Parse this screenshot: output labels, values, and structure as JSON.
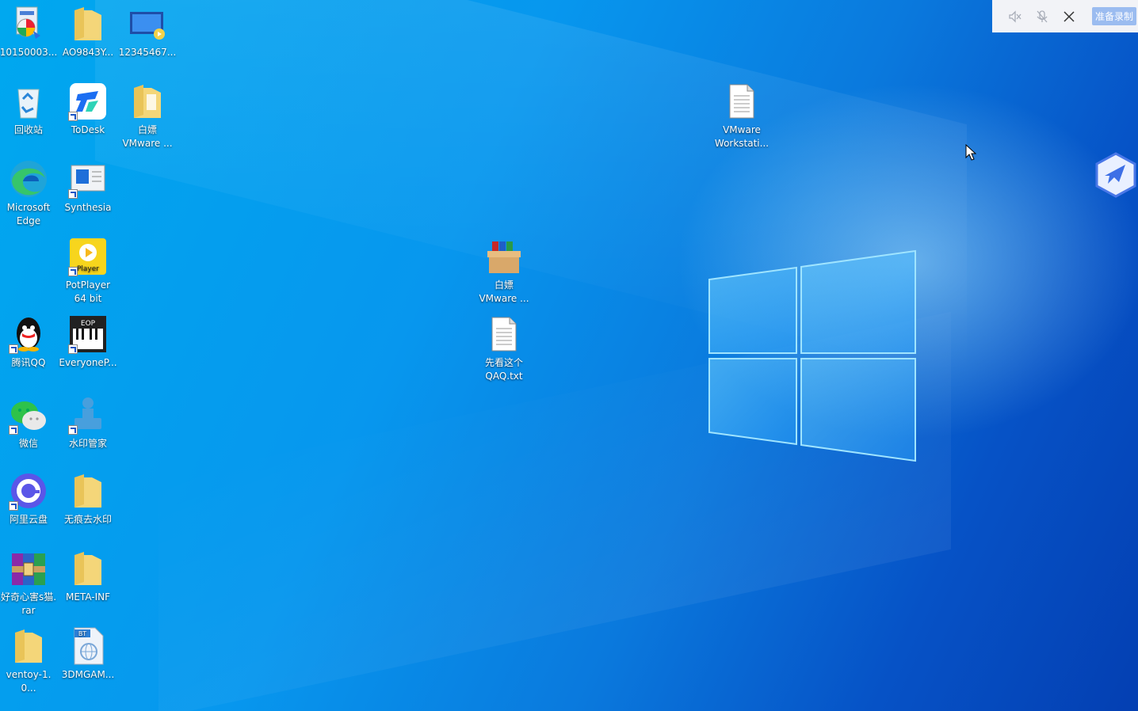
{
  "desktop": {
    "icons": [
      {
        "label": "10150003...",
        "icon": "installer-icon"
      },
      {
        "label": "AO9843Y...",
        "icon": "folder-icon"
      },
      {
        "label": "12345467...",
        "icon": "video-file-icon"
      },
      {
        "label": "回收站",
        "icon": "recycle-bin-icon"
      },
      {
        "label": "ToDesk",
        "icon": "todesk-icon"
      },
      {
        "label": "白嫖\nVMware ...",
        "icon": "folder-icon"
      },
      {
        "label": "Microsoft\nEdge",
        "icon": "edge-icon"
      },
      {
        "label": "Synthesia",
        "icon": "synthesia-icon"
      },
      {
        "label": "PotPlayer\n64 bit",
        "icon": "potplayer-icon"
      },
      {
        "label": "腾讯QQ",
        "icon": "qq-icon"
      },
      {
        "label": "EveryoneP...",
        "icon": "everyone-piano-icon"
      },
      {
        "label": "微信",
        "icon": "wechat-icon"
      },
      {
        "label": "水印管家",
        "icon": "watermark-manager-icon"
      },
      {
        "label": "阿里云盘",
        "icon": "aliyun-drive-icon"
      },
      {
        "label": "无痕去水印",
        "icon": "folder-icon"
      },
      {
        "label": "好奇心害s猫.\nrar",
        "icon": "winrar-archive-icon"
      },
      {
        "label": "META-INF",
        "icon": "folder-icon"
      },
      {
        "label": "ventoy-1.0...",
        "icon": "folder-icon"
      },
      {
        "label": "3DMGAM...",
        "icon": "bt-file-icon"
      },
      {
        "label": "白嫖\nVMware ...",
        "icon": "archive-box-icon"
      },
      {
        "label": "先看这个\nQAQ.txt",
        "icon": "text-file-icon"
      },
      {
        "label": "VMware\nWorkstati...",
        "icon": "text-file-icon"
      }
    ]
  },
  "recorder_toolbar": {
    "mute_icon": "speaker-muted-icon",
    "mic_icon": "mic-muted-icon",
    "close_icon": "close-icon",
    "record_label": "准备录制"
  },
  "colors": {
    "wallpaper_light": "#00a8ef",
    "wallpaper_dark": "#043fb2",
    "toolbar_bg": "#f2f3f7",
    "record_button": "#9bbcf0"
  }
}
